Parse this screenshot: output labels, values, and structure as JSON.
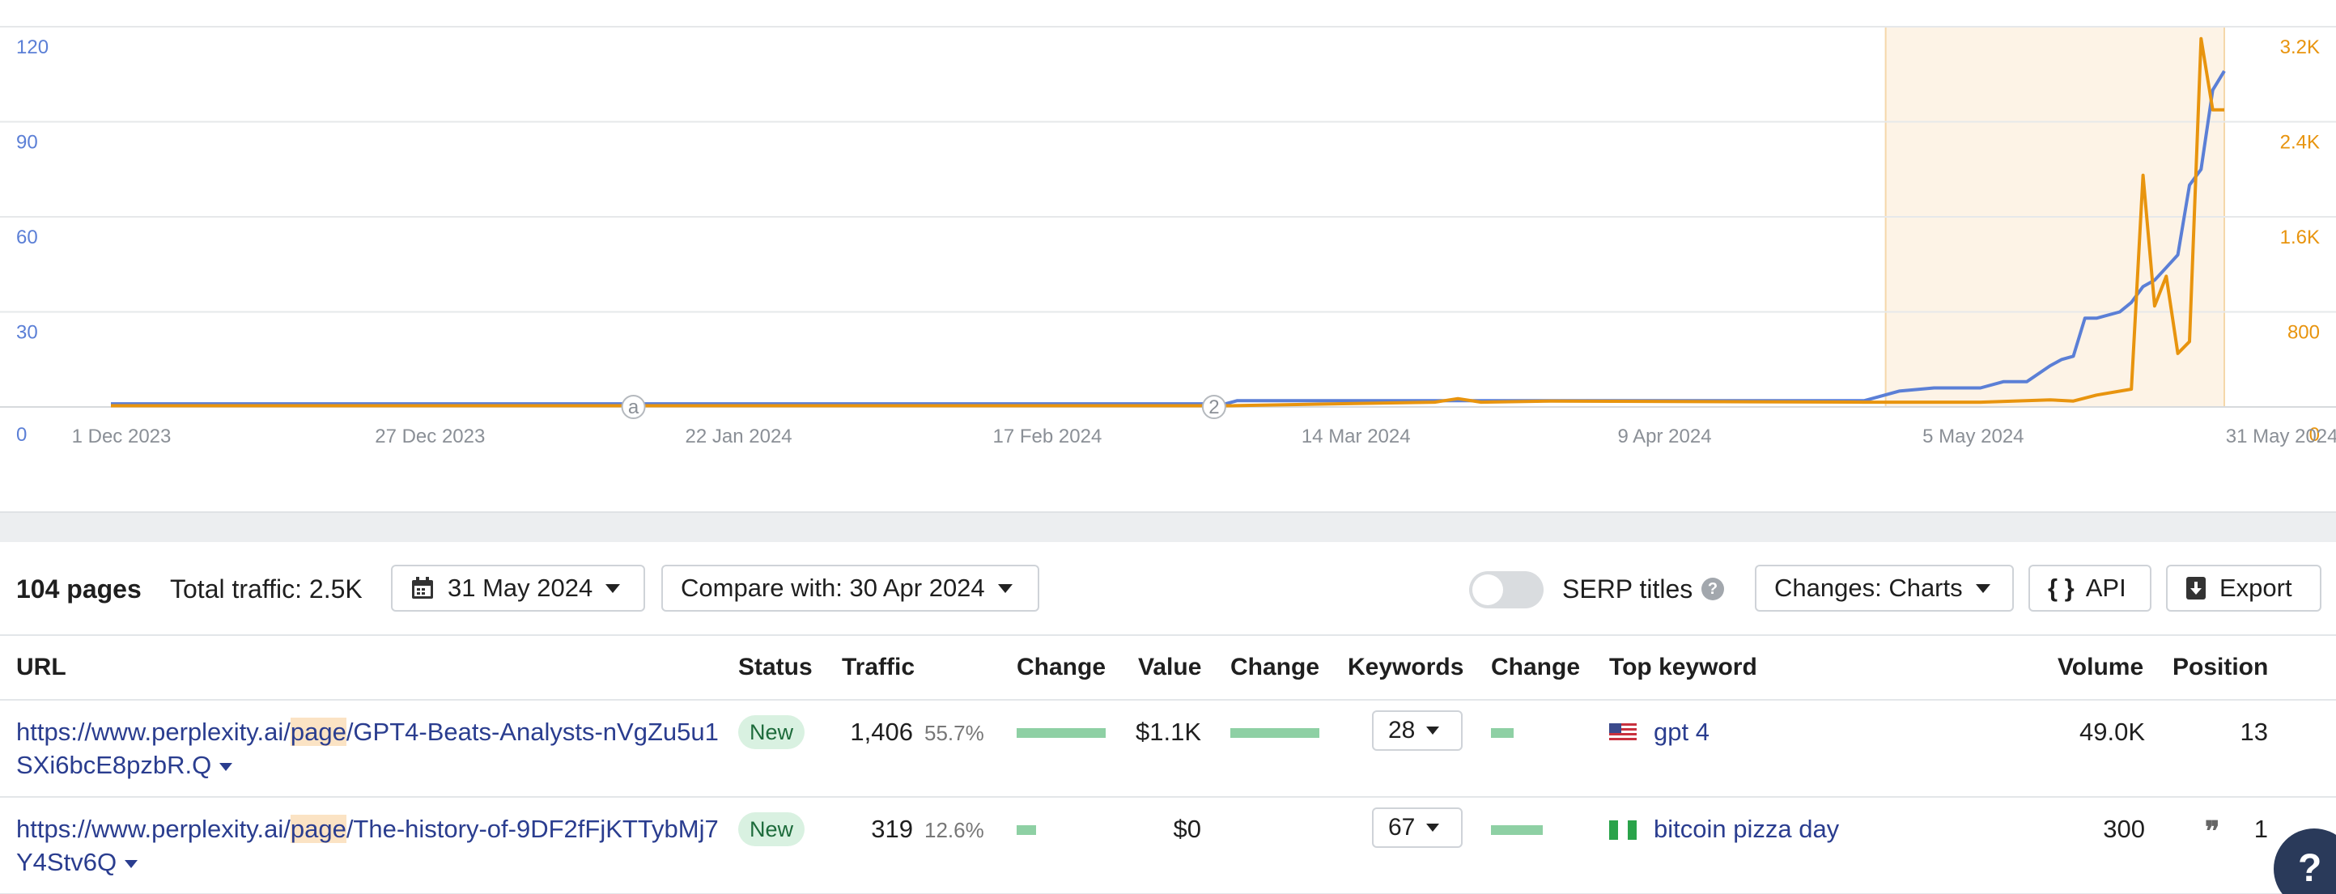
{
  "chart_data": {
    "type": "line",
    "x_labels": [
      "1 Dec 2023",
      "27 Dec 2023",
      "22 Jan 2024",
      "17 Feb 2024",
      "14 Mar 2024",
      "9 Apr 2024",
      "5 May 2024",
      "31 May 2024"
    ],
    "y_left_ticks": [
      "0",
      "30",
      "60",
      "90",
      "120"
    ],
    "y_right_ticks": [
      "0",
      "800",
      "1.6K",
      "2.4K",
      "3.2K"
    ],
    "y_left_lim": [
      0,
      120
    ],
    "y_right_lim": [
      0,
      3200
    ],
    "x_range": [
      "2023-12-01",
      "2024-05-31"
    ],
    "highlight_range": [
      "2024-05-01",
      "2024-05-31"
    ],
    "annotations": [
      {
        "date": "2024-01-15",
        "label": "a"
      },
      {
        "date": "2024-03-05",
        "label": "2"
      }
    ],
    "grid": true,
    "colors": {
      "pages": "#5b7fd6",
      "traffic": "#e8940e",
      "highlight": "#fdf3e6",
      "highlight_border": "#f5d7aa"
    },
    "series": [
      {
        "axis": "left",
        "points": [
          [
            "2023-12-01",
            1
          ],
          [
            "2024-03-06",
            1
          ],
          [
            "2024-03-07",
            2
          ],
          [
            "2024-04-30",
            2
          ],
          [
            "2024-05-01",
            3
          ],
          [
            "2024-05-03",
            5
          ],
          [
            "2024-05-06",
            6
          ],
          [
            "2024-05-10",
            6
          ],
          [
            "2024-05-12",
            8
          ],
          [
            "2024-05-14",
            8
          ],
          [
            "2024-05-16",
            13
          ],
          [
            "2024-05-17",
            15
          ],
          [
            "2024-05-18",
            16
          ],
          [
            "2024-05-19",
            28
          ],
          [
            "2024-05-20",
            28
          ],
          [
            "2024-05-22",
            30
          ],
          [
            "2024-05-23",
            33
          ],
          [
            "2024-05-24",
            38
          ],
          [
            "2024-05-25",
            40
          ],
          [
            "2024-05-26",
            44
          ],
          [
            "2024-05-27",
            48
          ],
          [
            "2024-05-28",
            70
          ],
          [
            "2024-05-29",
            75
          ],
          [
            "2024-05-30",
            100
          ],
          [
            "2024-05-31",
            106
          ]
        ]
      },
      {
        "axis": "right",
        "points": [
          [
            "2023-12-01",
            10
          ],
          [
            "2024-03-06",
            10
          ],
          [
            "2024-03-24",
            40
          ],
          [
            "2024-03-26",
            70
          ],
          [
            "2024-03-28",
            40
          ],
          [
            "2024-04-03",
            50
          ],
          [
            "2024-04-30",
            40
          ],
          [
            "2024-05-10",
            40
          ],
          [
            "2024-05-16",
            60
          ],
          [
            "2024-05-18",
            50
          ],
          [
            "2024-05-20",
            100
          ],
          [
            "2024-05-23",
            150
          ],
          [
            "2024-05-24",
            1950
          ],
          [
            "2024-05-25",
            850
          ],
          [
            "2024-05-26",
            1100
          ],
          [
            "2024-05-27",
            450
          ],
          [
            "2024-05-28",
            550
          ],
          [
            "2024-05-29",
            3100
          ],
          [
            "2024-05-30",
            2500
          ],
          [
            "2024-05-31",
            2500
          ]
        ]
      }
    ]
  },
  "toolbar": {
    "pages_count": "104 pages",
    "total_traffic": "Total traffic: 2.5K",
    "date": "31 May 2024",
    "compare": "Compare with: 30 Apr 2024",
    "serp_titles": "SERP titles",
    "help": "?",
    "changes": "Changes: Charts",
    "api": "API",
    "export": "Export",
    "api_icon": "{ }",
    "export_icon": "download-icon",
    "calendar_icon": "calendar-icon"
  },
  "table": {
    "headers": {
      "url": "URL",
      "status": "Status",
      "traffic": "Traffic",
      "change1": "Change",
      "value": "Value",
      "change2": "Change",
      "keywords": "Keywords",
      "change3": "Change",
      "top_keyword": "Top keyword",
      "volume": "Volume",
      "position": "Position"
    },
    "rows": [
      {
        "url_prefix": "https://www.perplexity.ai/",
        "url_highlight": "page",
        "url_suffix": "/GPT4-Beats-Analysts-nVgZu5u1SXi6bcE8pzbR.Q",
        "status": "New",
        "traffic": "1,406",
        "traffic_pct": "55.7%",
        "value": "$1.1K",
        "keywords": "28",
        "flag": "us",
        "top_keyword": "gpt 4",
        "volume": "49.0K",
        "position": "13"
      },
      {
        "url_prefix": "https://www.perplexity.ai/",
        "url_highlight": "page",
        "url_suffix": "/The-history-of-9DF2fFjKTTybMj7Y4Stv6Q",
        "status": "New",
        "traffic": "319",
        "traffic_pct": "12.6%",
        "value": "$0",
        "keywords": "67",
        "flag": "ng",
        "top_keyword": "bitcoin pizza day",
        "volume": "300",
        "position": "1"
      }
    ]
  },
  "help_fab": "?"
}
